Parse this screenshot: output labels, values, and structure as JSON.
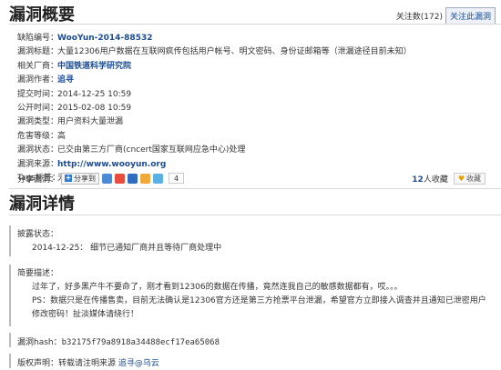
{
  "overview": {
    "title": "漏洞概要",
    "follow_count": "关注数(172)",
    "follow_button": "关注此漏洞"
  },
  "info": [
    {
      "label": "缺陷编号：",
      "value": "WooYun-2014-88532",
      "style": "link-bold"
    },
    {
      "label": "漏洞标题：",
      "value": "大量12306用户数据在互联网疯传包括用户帐号、明文密码、身份证邮箱等（泄漏途径目前未知）",
      "style": "plain"
    },
    {
      "label": "相关厂商：",
      "value": "中国铁道科学研究院",
      "style": "link"
    },
    {
      "label": "漏洞作者：",
      "value": "追寻",
      "style": "link"
    },
    {
      "label": "提交时间：",
      "value": "2014-12-25 10:59",
      "style": "plain"
    },
    {
      "label": "公开时间：",
      "value": "2015-02-08 10:59",
      "style": "plain"
    },
    {
      "label": "漏洞类型：",
      "value": "用户资料大量泄漏",
      "style": "plain"
    },
    {
      "label": "危害等级：",
      "value": "高",
      "style": "plain"
    },
    {
      "label": "漏洞状态：",
      "value": "已交由第三方厂商(cncert国家互联网应急中心)处理",
      "style": "plain"
    },
    {
      "label": "漏洞来源：",
      "value": "http://www.wooyun.org",
      "style": "link-bold"
    },
    {
      "label": "Tags标签：",
      "value": "无",
      "style": "plain"
    }
  ],
  "share": {
    "label": "分享漏洞：",
    "button": "分享到",
    "count": "4",
    "collect_count": "12",
    "collect_unit": "人收藏",
    "collect_button": "收藏"
  },
  "details": {
    "title": "漏洞详情",
    "disclosure_label": "披露状态：",
    "disclosure_text": "2014-12-25： 细节已通知厂商并且等待厂商处理中",
    "summary_label": "简要描述：",
    "summary_p1": "过年了，好多黑产牛不要命了，刚才看到12306的数据在传播，竟然连我自己的敏感数据都有，哎。。。",
    "summary_p2": "PS：数据只是在传播售卖，目前无法确认是12306官方还是第三方抢票平台泄漏，希望官方立即接入调查并且通知已泄密用户修改密码！扯淡媒体请绕行！",
    "hash_label": "漏洞hash：",
    "hash_value": "b32175f79a8918a34488ecf17ea65068",
    "copyright_label": "版权声明：",
    "copyright_text": "转载请注明来源",
    "copyright_link": "追寻@乌云"
  }
}
